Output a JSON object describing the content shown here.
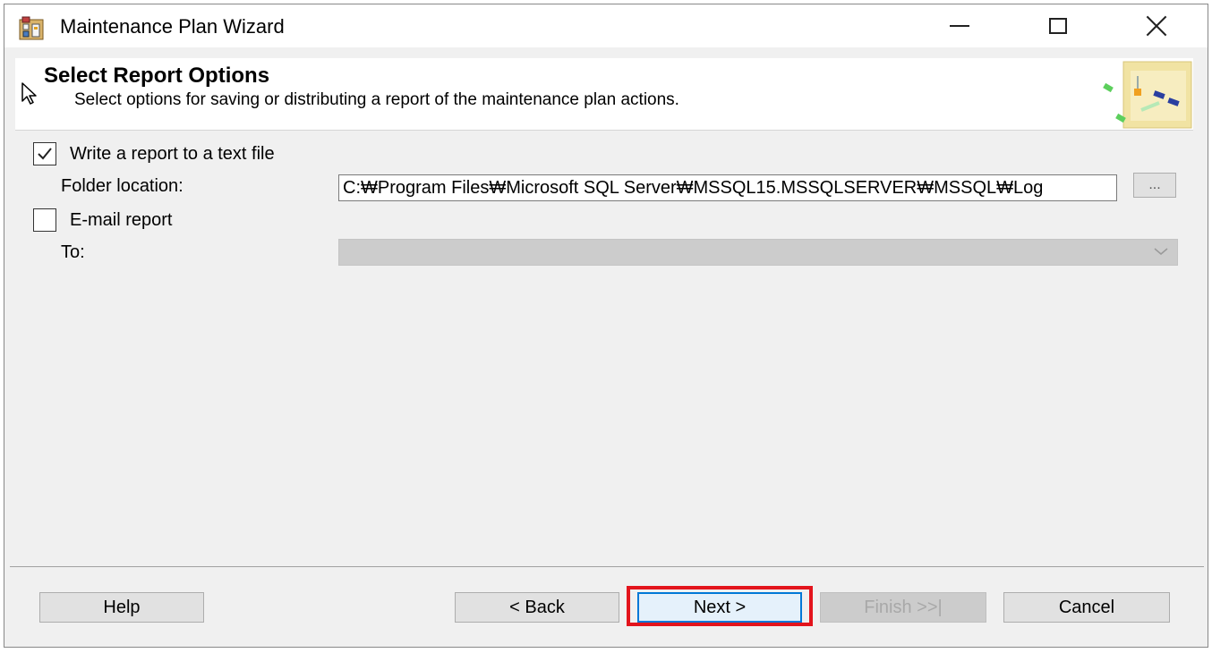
{
  "window": {
    "title": "Maintenance Plan Wizard",
    "controls": {
      "minimize": "minimize-icon",
      "maximize": "maximize-icon",
      "close": "close-icon"
    }
  },
  "header": {
    "title": "Select Report Options",
    "subtitle": "Select options for saving or distributing a report of the maintenance plan actions."
  },
  "options": {
    "write_report": {
      "label": "Write a report to a text file",
      "checked": true
    },
    "folder_location": {
      "label": "Folder location:",
      "value": "C:₩Program Files₩Microsoft SQL Server₩MSSQL15.MSSQLSERVER₩MSSQL₩Log",
      "browse_label": "..."
    },
    "email_report": {
      "label": "E-mail report",
      "checked": false
    },
    "to": {
      "label": "To:",
      "value": "",
      "enabled": false
    }
  },
  "buttons": {
    "help": "Help",
    "back": "< Back",
    "next": "Next >",
    "finish": "Finish >>|",
    "cancel": "Cancel"
  },
  "colors": {
    "highlight": "#e3141c",
    "window_bg": "#f0f0f0",
    "default_button_border": "#0078d7"
  }
}
